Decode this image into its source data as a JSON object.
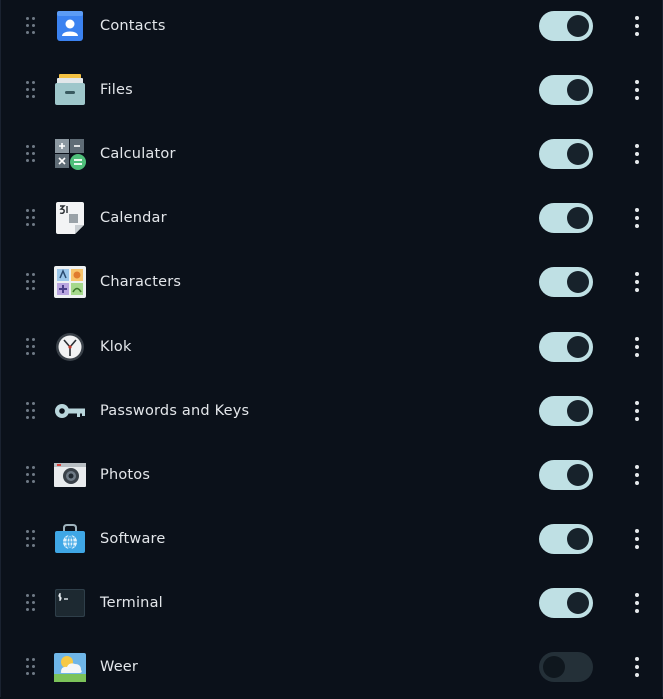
{
  "apps": [
    {
      "name": "Contacts",
      "icon": "contacts-icon",
      "enabled": true
    },
    {
      "name": "Files",
      "icon": "files-icon",
      "enabled": true
    },
    {
      "name": "Calculator",
      "icon": "calculator-icon",
      "enabled": true
    },
    {
      "name": "Calendar",
      "icon": "calendar-icon",
      "enabled": true
    },
    {
      "name": "Characters",
      "icon": "characters-icon",
      "enabled": true
    },
    {
      "name": "Klok",
      "icon": "clock-icon",
      "enabled": true
    },
    {
      "name": "Passwords and Keys",
      "icon": "key-icon",
      "enabled": true
    },
    {
      "name": "Photos",
      "icon": "camera-icon",
      "enabled": true
    },
    {
      "name": "Software",
      "icon": "software-bag-icon",
      "enabled": true
    },
    {
      "name": "Terminal",
      "icon": "terminal-icon",
      "enabled": true
    },
    {
      "name": "Weer",
      "icon": "weather-icon",
      "enabled": false
    }
  ],
  "colors": {
    "background": "#0b111a",
    "toggle_on": "#bfe0e4",
    "toggle_off": "#243038",
    "text": "#e3e6ea"
  }
}
